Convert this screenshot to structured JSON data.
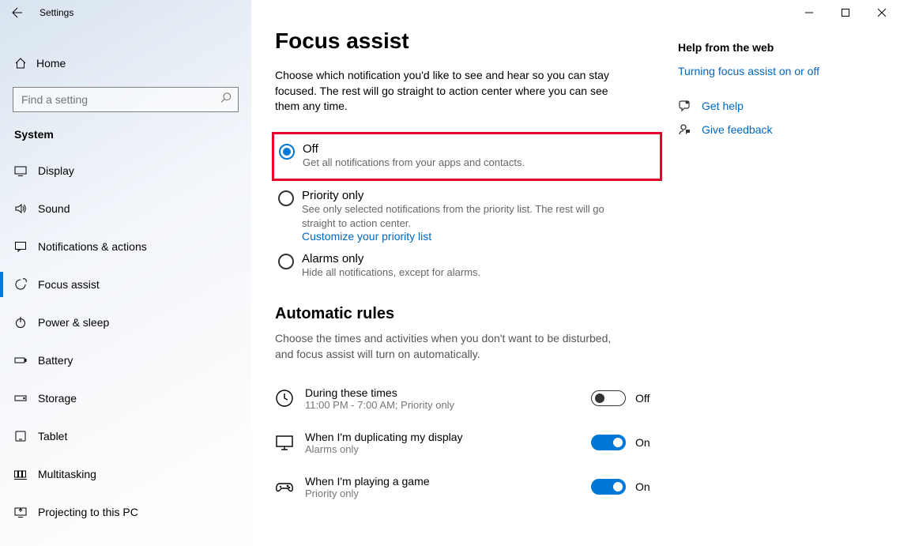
{
  "window": {
    "title": "Settings"
  },
  "sidebar": {
    "home": "Home",
    "search_placeholder": "Find a setting",
    "section": "System",
    "items": [
      {
        "label": "Display"
      },
      {
        "label": "Sound"
      },
      {
        "label": "Notifications & actions"
      },
      {
        "label": "Focus assist"
      },
      {
        "label": "Power & sleep"
      },
      {
        "label": "Battery"
      },
      {
        "label": "Storage"
      },
      {
        "label": "Tablet"
      },
      {
        "label": "Multitasking"
      },
      {
        "label": "Projecting to this PC"
      }
    ]
  },
  "page": {
    "title": "Focus assist",
    "description": "Choose which notification you'd like to see and hear so you can stay focused. The rest will go straight to action center where you can see them any time.",
    "options": {
      "off": {
        "label": "Off",
        "sub": "Get all notifications from your apps and contacts."
      },
      "priority": {
        "label": "Priority only",
        "sub": "See only selected notifications from the priority list. The rest will go straight to action center.",
        "link": "Customize your priority list"
      },
      "alarms": {
        "label": "Alarms only",
        "sub": "Hide all notifications, except for alarms."
      }
    },
    "auto_rules": {
      "heading": "Automatic rules",
      "description": "Choose the times and activities when you don't want to be disturbed, and focus assist will turn on automatically.",
      "rules": [
        {
          "title": "During these times",
          "sub": "11:00 PM - 7:00 AM; Priority only",
          "on": false,
          "state": "Off"
        },
        {
          "title": "When I'm duplicating my display",
          "sub": "Alarms only",
          "on": true,
          "state": "On"
        },
        {
          "title": "When I'm playing a game",
          "sub": "Priority only",
          "on": true,
          "state": "On"
        }
      ]
    }
  },
  "aside": {
    "heading": "Help from the web",
    "link1": "Turning focus assist on or off",
    "help": "Get help",
    "feedback": "Give feedback"
  }
}
